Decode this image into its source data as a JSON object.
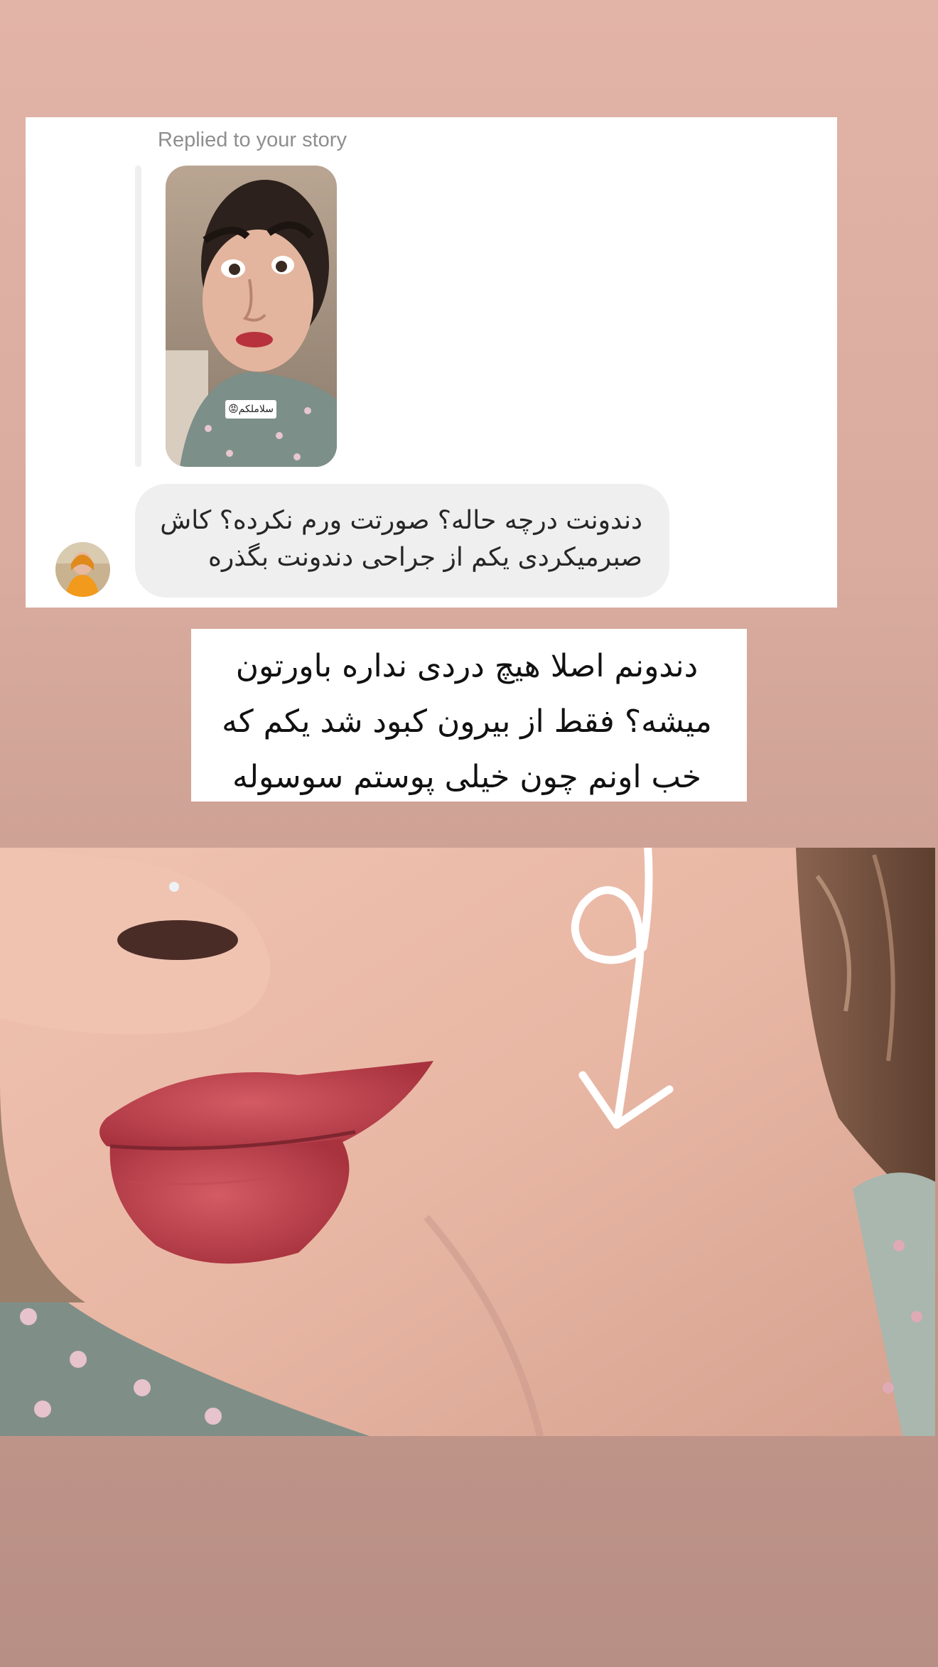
{
  "reply": {
    "label": "Replied to your story",
    "story_sticker_text": "سلاملکم😡",
    "message": "دندونت درچه حاله؟ صورتت ورم نکرده؟ کاش صبرمیکردی یکم از جراحی دندونت بگذره"
  },
  "caption": {
    "text": "دندونم اصلا هیچ دردی نداره باورتون میشه؟ فقط از بیرون کبود شد یکم که خب اونم چون خیلی پوستم سوسوله"
  },
  "icons": {
    "arrow": "hand-drawn-loop-arrow-down"
  },
  "colors": {
    "background_top": "#e2b3a7",
    "background_bottom": "#b88f85",
    "card": "#ffffff",
    "bubble": "#efefef",
    "label": "#8e8e8e"
  }
}
